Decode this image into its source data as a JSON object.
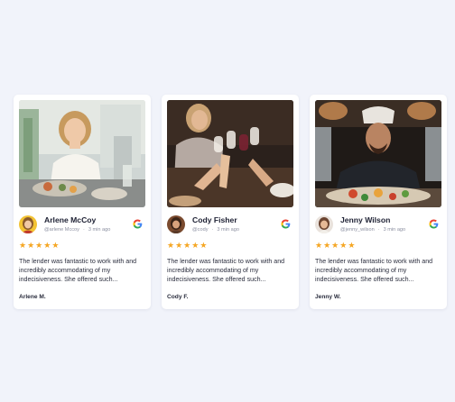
{
  "reviews": [
    {
      "name": "Arlene McCoy",
      "handle": "@arlene Mccoy",
      "time": "3 min ago",
      "stars": 5,
      "text": "The lender was fantastic to work with and incredibly accommodating of my indecisiveness. She offered such...",
      "signature": "Arlene M.",
      "photo": "woman-at-dinner-table-photo"
    },
    {
      "name": "Cody Fisher",
      "handle": "@cody",
      "time": "3 min ago",
      "stars": 5,
      "text": "The lender was fantastic to work with and incredibly accommodating of my indecisiveness. She offered such...",
      "signature": "Cody F.",
      "photo": "friends-toasting-wine-photo"
    },
    {
      "name": "Jenny Wilson",
      "handle": "@jenny_wilson",
      "time": "3 min ago",
      "stars": 5,
      "text": "The lender was fantastic to work with and incredibly accommodating of my indecisiveness. She offered such...",
      "signature": "Jenny W.",
      "photo": "chef-with-dish-photo"
    }
  ],
  "colors": {
    "background": "#f1f3fa",
    "card": "#ffffff",
    "star": "#f5a623",
    "name": "#1d2033",
    "muted": "#8b8fa0"
  },
  "icons": {
    "source": "google-icon",
    "rating": "star-icon"
  },
  "separator": "·"
}
